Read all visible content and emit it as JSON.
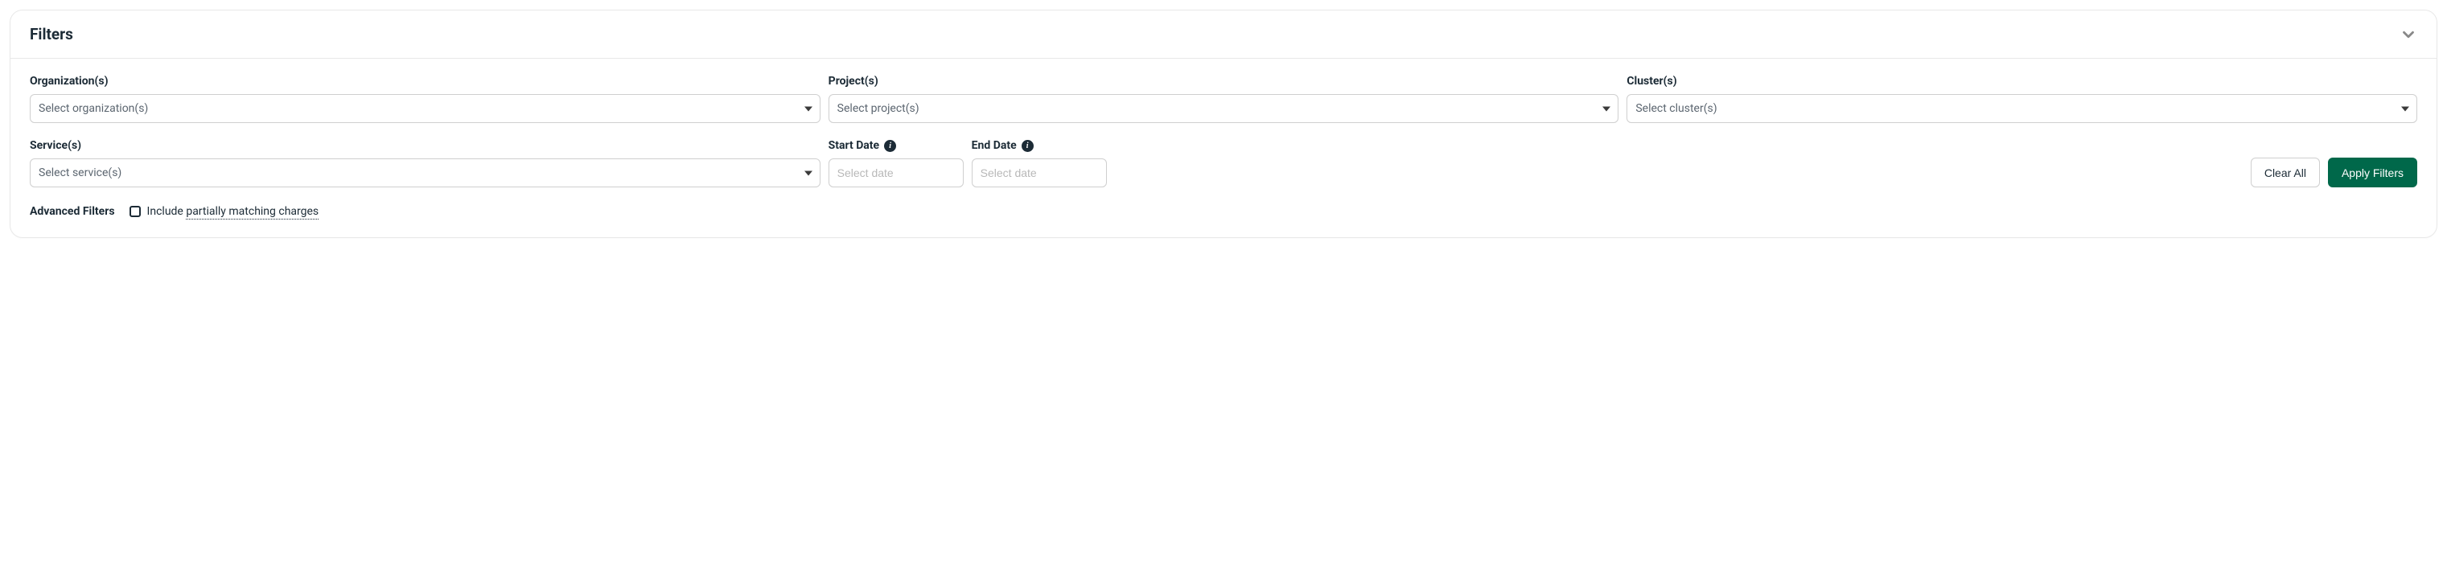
{
  "panel": {
    "title": "Filters"
  },
  "fields": {
    "organization": {
      "label": "Organization(s)",
      "placeholder": "Select organization(s)"
    },
    "project": {
      "label": "Project(s)",
      "placeholder": "Select project(s)"
    },
    "cluster": {
      "label": "Cluster(s)",
      "placeholder": "Select cluster(s)"
    },
    "service": {
      "label": "Service(s)",
      "placeholder": "Select service(s)"
    },
    "startDate": {
      "label": "Start Date",
      "placeholder": "Select date"
    },
    "endDate": {
      "label": "End Date",
      "placeholder": "Select date"
    }
  },
  "actions": {
    "clear": "Clear All",
    "apply": "Apply Filters"
  },
  "advanced": {
    "title": "Advanced Filters",
    "includePrefix": "Include ",
    "includeDotted": "partially matching charges"
  }
}
